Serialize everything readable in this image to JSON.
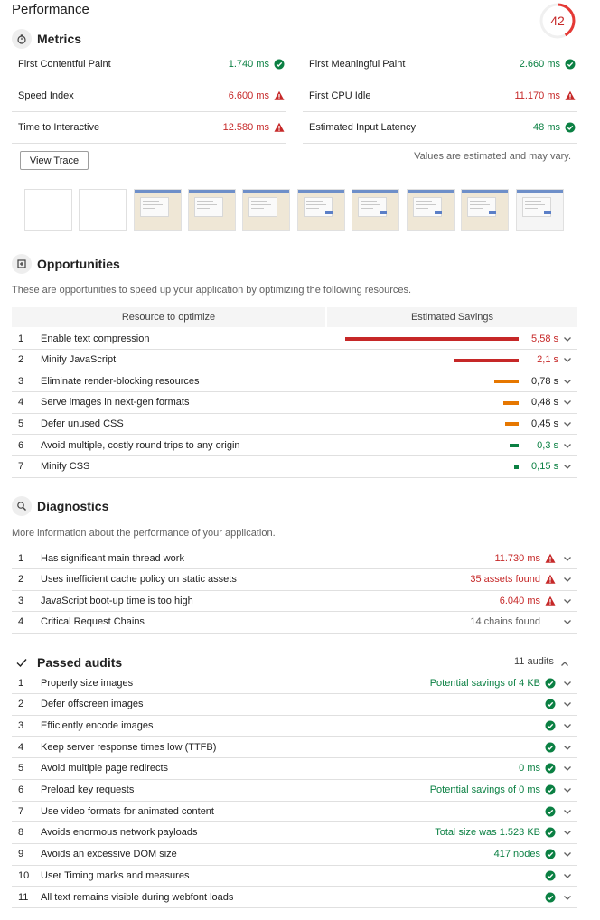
{
  "title": "Performance",
  "score": "42",
  "score_fraction": 0.42,
  "colors": {
    "pass": "#0b8043",
    "fail": "#c62828",
    "average": "#e67700",
    "fail_bar": "#c62828"
  },
  "metrics": {
    "section_title": "Metrics",
    "icon": "stopwatch-icon",
    "items": [
      {
        "label": "First Contentful Paint",
        "value": "1.740 ms",
        "status": "pass"
      },
      {
        "label": "First Meaningful Paint",
        "value": "2.660 ms",
        "status": "pass"
      },
      {
        "label": "Speed Index",
        "value": "6.600 ms",
        "status": "fail"
      },
      {
        "label": "First CPU Idle",
        "value": "11.170 ms",
        "status": "fail"
      },
      {
        "label": "Time to Interactive",
        "value": "12.580 ms",
        "status": "fail"
      },
      {
        "label": "Estimated Input Latency",
        "value": "48 ms",
        "status": "pass"
      }
    ],
    "view_trace": "View Trace",
    "note": "Values are estimated and may vary."
  },
  "opportunities": {
    "section_title": "Opportunities",
    "icon": "opportunity-icon",
    "description": "These are opportunities to speed up your application by optimizing the following resources.",
    "col_resource": "Resource to optimize",
    "col_savings": "Estimated Savings",
    "items": [
      {
        "num": "1",
        "label": "Enable text compression",
        "value": "5,58 s",
        "savings": 5.58,
        "status": "fail"
      },
      {
        "num": "2",
        "label": "Minify JavaScript",
        "value": "2,1 s",
        "savings": 2.1,
        "status": "fail"
      },
      {
        "num": "3",
        "label": "Eliminate render-blocking resources",
        "value": "0,78 s",
        "savings": 0.78,
        "status": "average"
      },
      {
        "num": "4",
        "label": "Serve images in next-gen formats",
        "value": "0,48 s",
        "savings": 0.48,
        "status": "average"
      },
      {
        "num": "5",
        "label": "Defer unused CSS",
        "value": "0,45 s",
        "savings": 0.45,
        "status": "average"
      },
      {
        "num": "6",
        "label": "Avoid multiple, costly round trips to any origin",
        "value": "0,3 s",
        "savings": 0.3,
        "status": "pass"
      },
      {
        "num": "7",
        "label": "Minify CSS",
        "value": "0,15 s",
        "savings": 0.15,
        "status": "pass"
      }
    ]
  },
  "diagnostics": {
    "section_title": "Diagnostics",
    "icon": "search-icon",
    "description": "More information about the performance of your application.",
    "items": [
      {
        "num": "1",
        "label": "Has significant main thread work",
        "value": "11.730 ms",
        "status": "fail"
      },
      {
        "num": "2",
        "label": "Uses inefficient cache policy on static assets",
        "value": "35 assets found",
        "status": "fail"
      },
      {
        "num": "3",
        "label": "JavaScript boot-up time is too high",
        "value": "6.040 ms",
        "status": "fail"
      },
      {
        "num": "4",
        "label": "Critical Request Chains",
        "value": "14 chains found",
        "status": "info"
      }
    ]
  },
  "passed": {
    "section_title": "Passed audits",
    "icon": "checkmark-icon",
    "count_label": "11 audits",
    "items": [
      {
        "num": "1",
        "label": "Properly size images",
        "value": "Potential savings of 4 KB"
      },
      {
        "num": "2",
        "label": "Defer offscreen images",
        "value": ""
      },
      {
        "num": "3",
        "label": "Efficiently encode images",
        "value": ""
      },
      {
        "num": "4",
        "label": "Keep server response times low (TTFB)",
        "value": ""
      },
      {
        "num": "5",
        "label": "Avoid multiple page redirects",
        "value": "0 ms"
      },
      {
        "num": "6",
        "label": "Preload key requests",
        "value": "Potential savings of 0 ms"
      },
      {
        "num": "7",
        "label": "Use video formats for animated content",
        "value": ""
      },
      {
        "num": "8",
        "label": "Avoids enormous network payloads",
        "value": "Total size was 1.523 KB"
      },
      {
        "num": "9",
        "label": "Avoids an excessive DOM size",
        "value": "417 nodes"
      },
      {
        "num": "10",
        "label": "User Timing marks and measures",
        "value": ""
      },
      {
        "num": "11",
        "label": "All text remains visible during webfont loads",
        "value": ""
      }
    ]
  }
}
